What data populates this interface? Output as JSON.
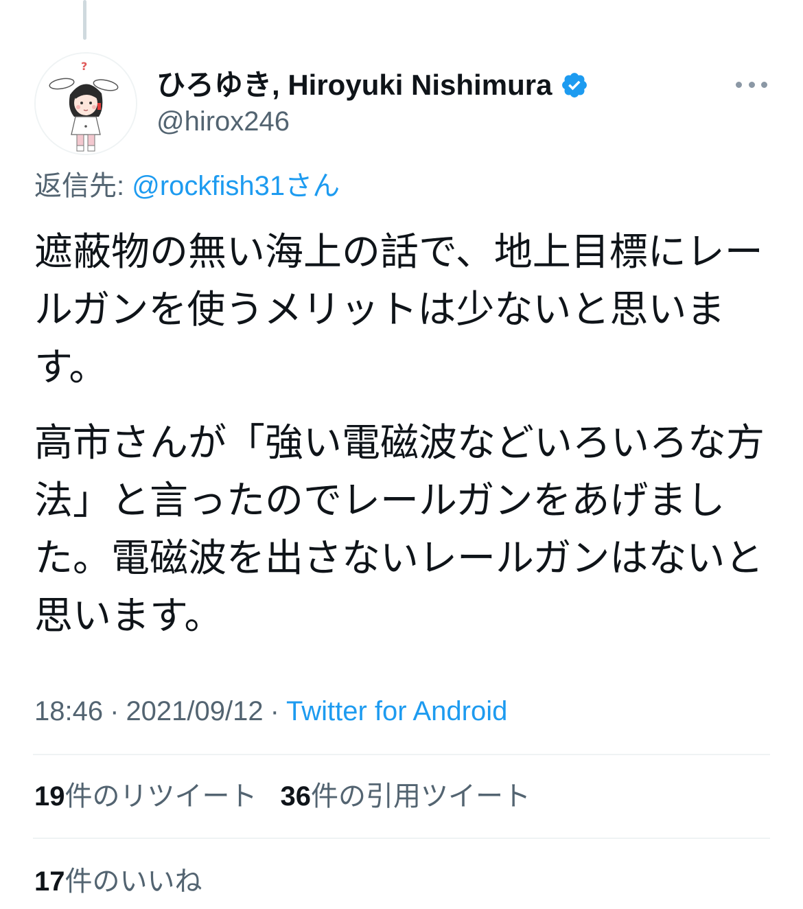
{
  "author": {
    "display_name": "ひろゆき, Hiroyuki Nishimura",
    "handle": "@hirox246",
    "verified": true,
    "avatar_icon": "avatar-bunny-character"
  },
  "reply": {
    "prefix": "返信先: ",
    "mention": "@rockfish31",
    "suffix": "さん"
  },
  "tweet": {
    "paragraphs": [
      "遮蔽物の無い海上の話で、地上目標にレールガンを使うメリットは少ないと思います。",
      "高市さんが「強い電磁波などいろいろな方法」と言ったのでレールガンをあげました。電磁波を出さないレールガンはないと思います。"
    ]
  },
  "meta": {
    "time": "18:46",
    "separator": "·",
    "date": "2021/09/12",
    "source": "Twitter for Android"
  },
  "stats": {
    "retweets": {
      "count": "19",
      "label": "件のリツイート"
    },
    "quotes": {
      "count": "36",
      "label": "件の引用ツイート"
    },
    "likes": {
      "count": "17",
      "label": "件のいいね"
    }
  },
  "colors": {
    "link": "#1d9bf0",
    "secondary_text": "#536471",
    "primary_text": "#0f1419",
    "divider": "#eff3f4"
  }
}
